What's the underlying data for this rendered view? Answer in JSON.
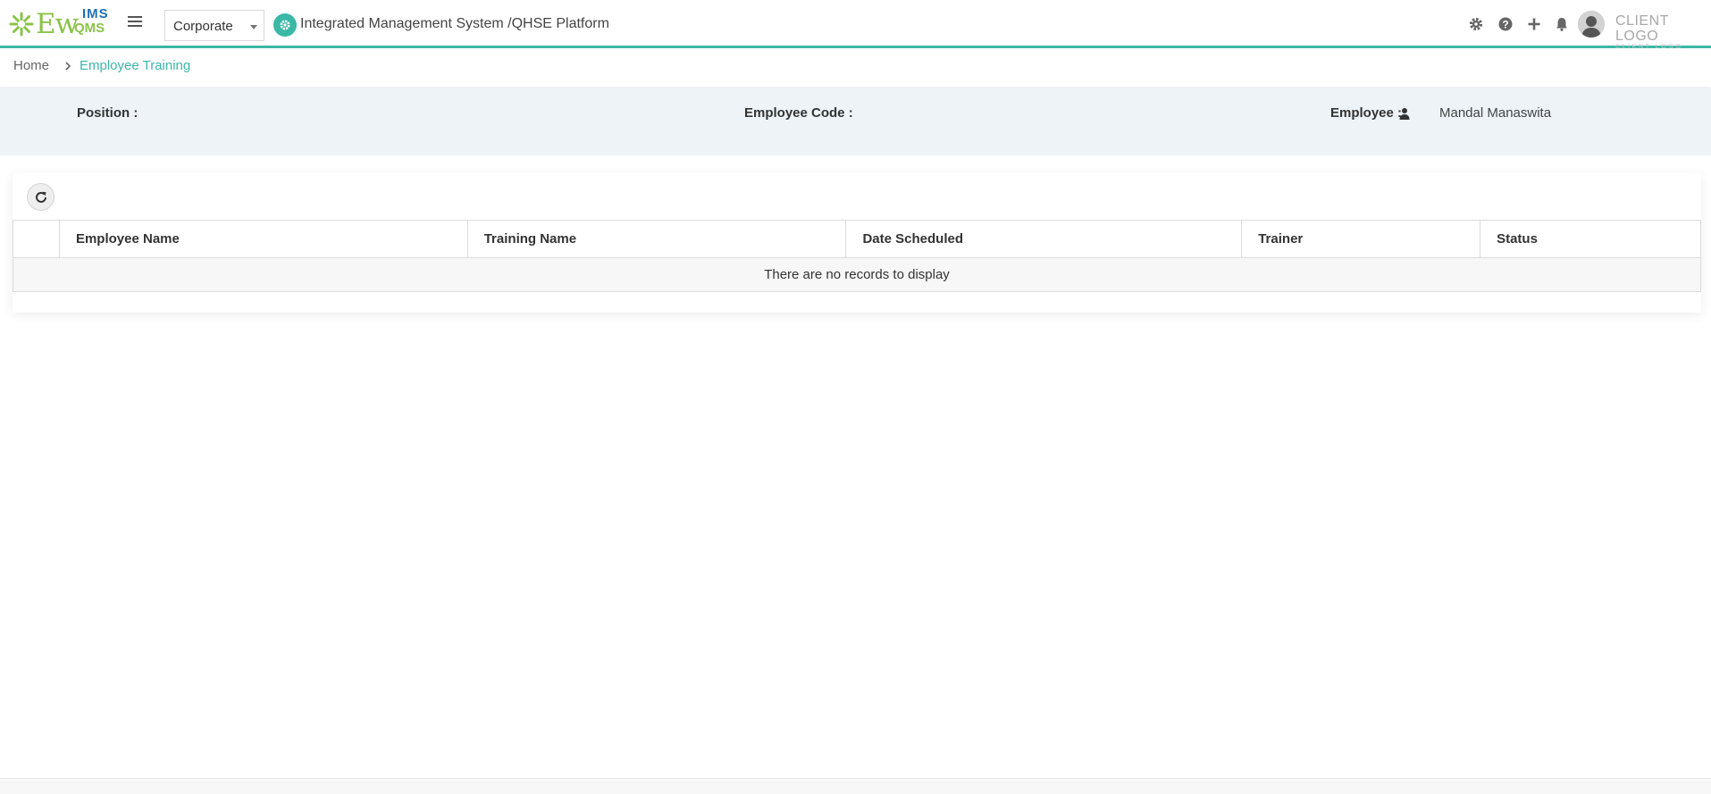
{
  "header": {
    "logo": {
      "main": "Ew",
      "ims": "IMS",
      "qms": "QMS"
    },
    "org_select": {
      "value": "Corporate"
    },
    "app_title": "Integrated Management System /QHSE Platform",
    "icons": [
      "gear-icon",
      "help-icon",
      "plus-icon",
      "bell-icon",
      "avatar"
    ],
    "client_logo": {
      "main": "CLIENT LOGO",
      "sub": "CLIENT LOGO"
    }
  },
  "breadcrumb": {
    "home": "Home",
    "current": "Employee Training"
  },
  "info": {
    "position_label": "Position :",
    "employee_code_label": "Employee Code :",
    "employee_label": "Employee :",
    "employee_value": "Mandal Manaswita"
  },
  "table": {
    "columns": [
      "",
      "Employee Name",
      "Training Name",
      "Date Scheduled",
      "Trainer",
      "Status"
    ],
    "empty_message": "There are no records to display"
  },
  "colors": {
    "accent": "#3bb8a6",
    "logo_green": "#8bc34a",
    "logo_blue": "#1e6fb5",
    "info_band": "#edf3f7"
  }
}
